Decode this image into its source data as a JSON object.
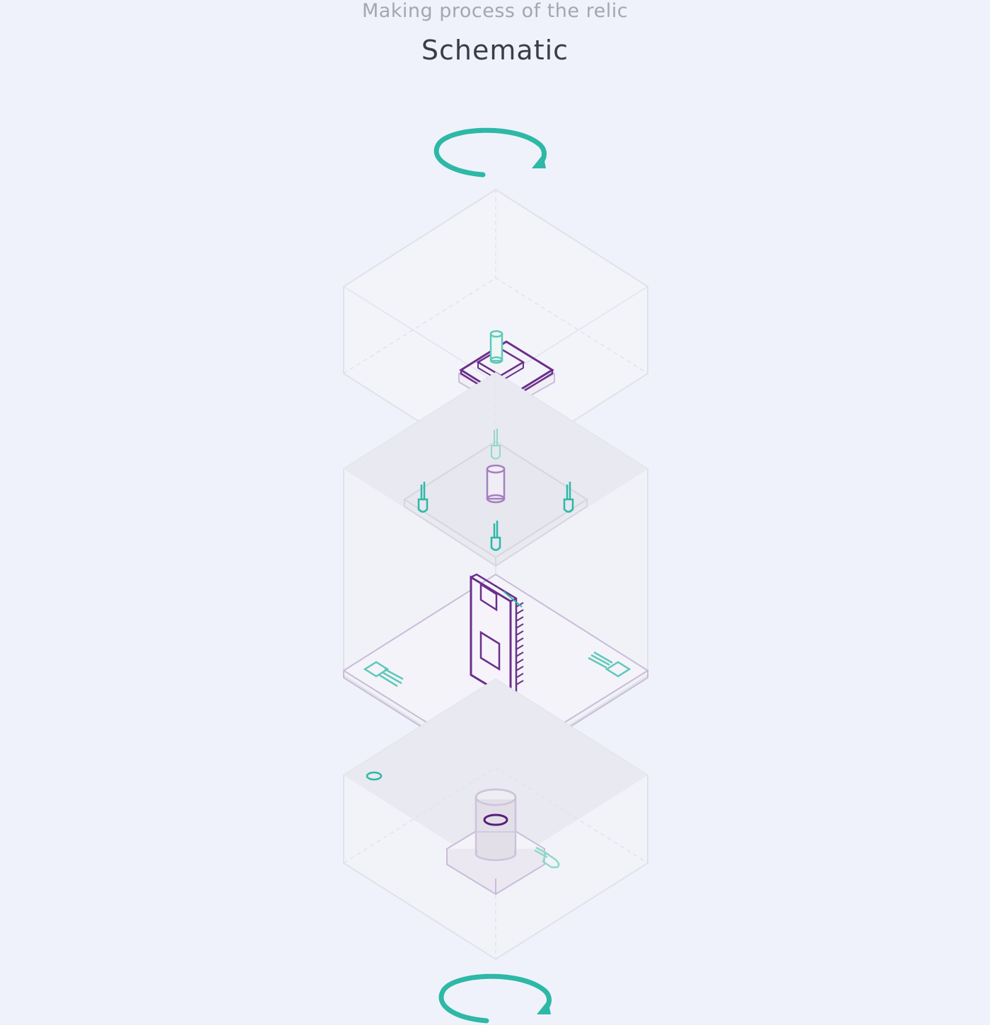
{
  "header": {
    "subtitle": "Making process of the relic",
    "title": "Schematic"
  },
  "colors": {
    "background": "#eff2fa",
    "teal": "#2db8a7",
    "purple": "#6b2f8a",
    "box_line": "#dcdde5"
  },
  "controls": {
    "rotate_top_icon": "rotate-clockwise-icon",
    "rotate_bottom_icon": "rotate-clockwise-icon"
  }
}
